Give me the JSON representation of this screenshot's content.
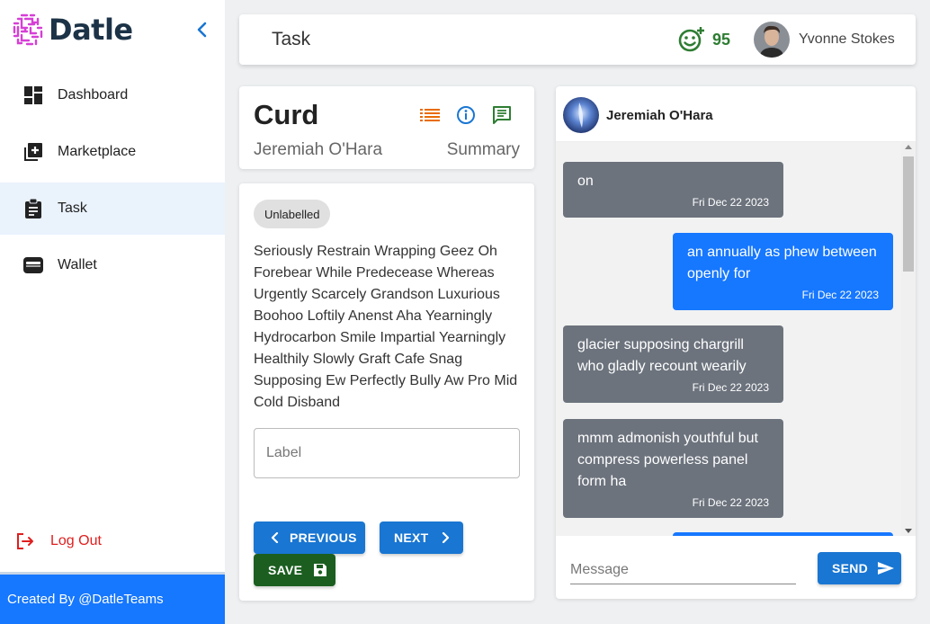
{
  "brand": {
    "name": "Datle",
    "logo_icon": "maze-logo-icon",
    "collapse_icon": "chevron-left-icon"
  },
  "sidebar": {
    "items": [
      {
        "label": "Dashboard",
        "icon": "dashboard-icon"
      },
      {
        "label": "Marketplace",
        "icon": "add-box-icon"
      },
      {
        "label": "Task",
        "icon": "clipboard-icon"
      },
      {
        "label": "Wallet",
        "icon": "wallet-icon"
      }
    ],
    "logout_label": "Log Out",
    "footer": "Created By @DatleTeams"
  },
  "header": {
    "title": "Task",
    "score": "95",
    "user_name": "Yvonne Stokes"
  },
  "task": {
    "title": "Curd",
    "author": "Jeremiah O'Hara",
    "summary_link": "Summary",
    "chip": "Unlabelled",
    "description": "Seriously Restrain Wrapping Geez Oh Forebear While Predecease Whereas Urgently Scarcely Grandson Luxurious Boohoo Loftily Anenst Aha Yearningly Hydrocarbon Smile Impartial Yearningly Healthily Slowly Graft Cafe Snag Supposing Ew Perfectly Bully Aw Pro Mid Cold Disband",
    "label_placeholder": "Label",
    "prev_label": "PREVIOUS",
    "next_label": "NEXT",
    "save_label": "SAVE"
  },
  "chat": {
    "contact_name": "Jeremiah O'Hara",
    "messages": [
      {
        "text": "on",
        "time": "Fri Dec 22 2023",
        "direction": "in"
      },
      {
        "text": "an annually as phew between openly for",
        "time": "Fri Dec 22 2023",
        "direction": "out"
      },
      {
        "text": "glacier supposing chargrill who gladly recount wearily",
        "time": "Fri Dec 22 2023",
        "direction": "in"
      },
      {
        "text": "mmm admonish youthful but compress powerless panel form ha",
        "time": "Fri Dec 22 2023",
        "direction": "in"
      }
    ],
    "input_placeholder": "Message",
    "send_label": "SEND"
  },
  "colors": {
    "primary": "#1976d2",
    "footer": "#1677ff",
    "save": "#1b5e20",
    "incoming_bubble": "#6c737d",
    "outgoing_bubble": "#1677ff",
    "logout": "#e01e1e",
    "score": "#2e7d32"
  }
}
